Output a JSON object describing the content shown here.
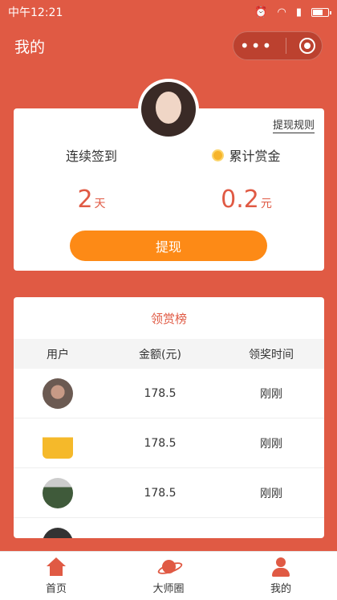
{
  "status_bar": {
    "time": "中午12:21"
  },
  "nav": {
    "title": "我的",
    "capsule_more": "•••"
  },
  "profile": {
    "rules_link": "提现规则",
    "checkin_label": "连续签到",
    "checkin_value": "2",
    "checkin_unit": "天",
    "bounty_label": "累计赏金",
    "bounty_value": "0.2",
    "bounty_unit": "元",
    "withdraw_label": "提现"
  },
  "board": {
    "title": "领赏榜",
    "headers": {
      "user": "用户",
      "amount": "金额(元)",
      "time": "领奖时间"
    },
    "rows": [
      {
        "amount": "178.5",
        "time": "刚刚"
      },
      {
        "amount": "178.5",
        "time": "刚刚"
      },
      {
        "amount": "178.5",
        "time": "刚刚"
      }
    ]
  },
  "tabs": [
    {
      "label": "首页",
      "icon": "home-icon"
    },
    {
      "label": "大师圈",
      "icon": "planet-icon"
    },
    {
      "label": "我的",
      "icon": "user-icon"
    }
  ],
  "colors": {
    "primary": "#e05a44",
    "button": "#fd8a16"
  }
}
